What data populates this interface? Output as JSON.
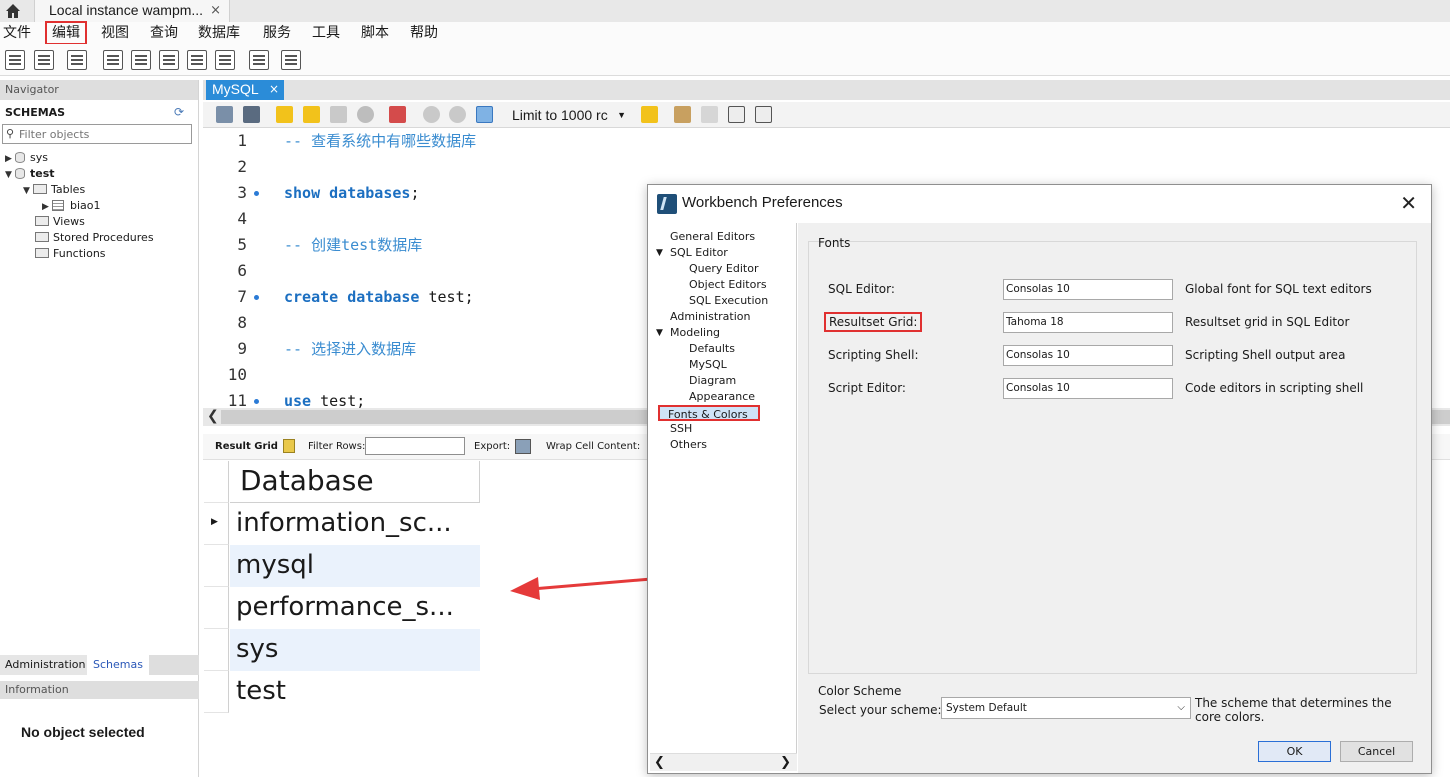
{
  "tab": {
    "title": "Local instance wampm...",
    "close": "×"
  },
  "menu": [
    "文件",
    "编辑",
    "视图",
    "查询",
    "数据库",
    "服务",
    "工具",
    "脚本",
    "帮助"
  ],
  "navigator": {
    "header": "Navigator",
    "schemas_title": "SCHEMAS",
    "filter_placeholder": "Filter objects",
    "tree": {
      "sys": "sys",
      "test": "test",
      "tables": "Tables",
      "biao1": "biao1",
      "views": "Views",
      "procedures": "Stored Procedures",
      "functions": "Functions"
    },
    "tab_admin": "Administration",
    "tab_schemas": "Schemas",
    "info_header": "Information",
    "no_object": "No object selected"
  },
  "editor": {
    "tab": "MySQL",
    "tab_close": "×",
    "limit": "Limit to 1000 rc",
    "lines": [
      {
        "n": "1",
        "text": "-- 查看系统中有哪些数据库",
        "kind": "comment",
        "dot": false
      },
      {
        "n": "2",
        "text": "",
        "kind": "plain",
        "dot": false
      },
      {
        "n": "3",
        "kw": "show databases",
        "rest": ";",
        "kind": "keyword",
        "dot": true
      },
      {
        "n": "4",
        "text": "",
        "kind": "plain",
        "dot": false
      },
      {
        "n": "5",
        "text": "-- 创建test数据库",
        "kind": "comment",
        "dot": false
      },
      {
        "n": "6",
        "text": "",
        "kind": "plain",
        "dot": false
      },
      {
        "n": "7",
        "kw": "create database",
        "rest": " test;",
        "kind": "keyword",
        "dot": true
      },
      {
        "n": "8",
        "text": "",
        "kind": "plain",
        "dot": false
      },
      {
        "n": "9",
        "text": "-- 选择进入数据库",
        "kind": "comment",
        "dot": false
      },
      {
        "n": "10",
        "text": "",
        "kind": "plain",
        "dot": false
      },
      {
        "n": "11",
        "kw": "use",
        "rest": " test;",
        "kind": "keyword",
        "dot": true
      }
    ]
  },
  "result": {
    "grid_label": "Result Grid",
    "filter_label": "Filter Rows:",
    "export_label": "Export:",
    "wrap_label": "Wrap Cell Content:",
    "column": "Database",
    "rows": [
      "information_sc...",
      "mysql",
      "performance_s...",
      "sys",
      "test"
    ]
  },
  "prefs": {
    "title": "Workbench Preferences",
    "tree": [
      {
        "label": "General Editors",
        "level": 0,
        "expand": ""
      },
      {
        "label": "SQL Editor",
        "level": 0,
        "expand": "▼"
      },
      {
        "label": "Query Editor",
        "level": 1,
        "expand": ""
      },
      {
        "label": "Object Editors",
        "level": 1,
        "expand": ""
      },
      {
        "label": "SQL Execution",
        "level": 1,
        "expand": ""
      },
      {
        "label": "Administration",
        "level": 0,
        "expand": ""
      },
      {
        "label": "Modeling",
        "level": 0,
        "expand": "▼"
      },
      {
        "label": "Defaults",
        "level": 1,
        "expand": ""
      },
      {
        "label": "MySQL",
        "level": 1,
        "expand": ""
      },
      {
        "label": "Diagram",
        "level": 1,
        "expand": ""
      },
      {
        "label": "Appearance",
        "level": 1,
        "expand": ""
      },
      {
        "label": "Fonts & Colors",
        "level": 0,
        "expand": ""
      },
      {
        "label": "SSH",
        "level": 0,
        "expand": ""
      },
      {
        "label": "Others",
        "level": 0,
        "expand": ""
      }
    ],
    "fonts_group": "Fonts",
    "fonts": [
      {
        "label": "SQL Editor:",
        "value": "Consolas 10",
        "desc": "Global font for SQL text editors"
      },
      {
        "label": "Resultset Grid:",
        "value": "Tahoma 18",
        "desc": "Resultset grid in SQL Editor"
      },
      {
        "label": "Scripting Shell:",
        "value": "Consolas 10",
        "desc": "Scripting Shell output area"
      },
      {
        "label": "Script Editor:",
        "value": "Consolas 10",
        "desc": "Code editors in scripting shell"
      }
    ],
    "color_group": "Color Scheme",
    "scheme_label": "Select your scheme:",
    "scheme_value": "System Default",
    "scheme_desc": "The scheme that determines the core colors.",
    "ok": "OK",
    "cancel": "Cancel"
  },
  "colors": {
    "accent_blue": "#2b8cd8",
    "highlight_red": "#e03030",
    "grid_alt": "#eaf2fc"
  }
}
